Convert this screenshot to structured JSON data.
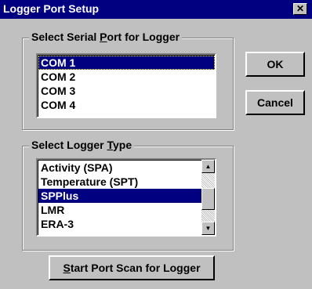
{
  "window": {
    "title": "Logger Port Setup",
    "close_glyph": "✕"
  },
  "serial_group": {
    "label_before": "Select Serial ",
    "label_hotkey": "P",
    "label_after": "ort for Logger",
    "items": [
      "COM 1",
      "COM 2",
      "COM 3",
      "COM 4"
    ],
    "selected": "COM 1"
  },
  "type_group": {
    "label_before": "Select Logger ",
    "label_hotkey": "T",
    "label_after": "ype",
    "items": [
      "Activity (SPA)",
      "Temperature (SPT)",
      "SPPlus",
      "LMR",
      "ERA-3"
    ],
    "selected": "SPPlus",
    "scroll_position": 0.55
  },
  "buttons": {
    "ok": "OK",
    "cancel": "Cancel",
    "scan_hotkey": "S",
    "scan_rest": "tart Port Scan for Logger"
  },
  "icons": {
    "scroll_up": "up-arrow-icon",
    "scroll_down": "down-arrow-icon",
    "close": "close-icon"
  },
  "colors": {
    "titlebar": "#000080",
    "face": "#c0c0c0",
    "selection": "#000080"
  }
}
